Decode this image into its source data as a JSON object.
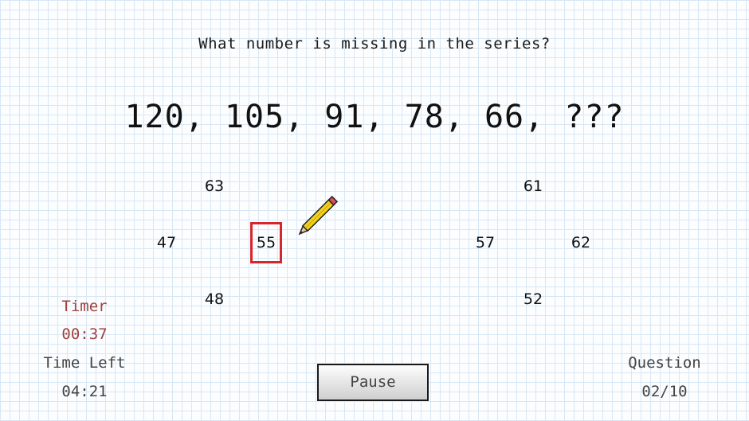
{
  "question": "What number is missing in the series?",
  "series": "120, 105, 91, 78, 66, ???",
  "options": {
    "o63": "63",
    "o61": "61",
    "o47": "47",
    "o55": "55",
    "o57": "57",
    "o62": "62",
    "o48": "48",
    "o52": "52"
  },
  "selected_option": "55",
  "timer": {
    "label": "Timer",
    "value": "00:37"
  },
  "time_left": {
    "label": "Time Left",
    "value": "04:21"
  },
  "question_counter": {
    "label": "Question",
    "value": "02/10"
  },
  "pause_label": "Pause",
  "colors": {
    "selection_border": "#d6262b",
    "timer_text": "#a0403c",
    "grid_line": "#d9e7f3"
  },
  "icons": {
    "cursor": "pencil-icon"
  }
}
